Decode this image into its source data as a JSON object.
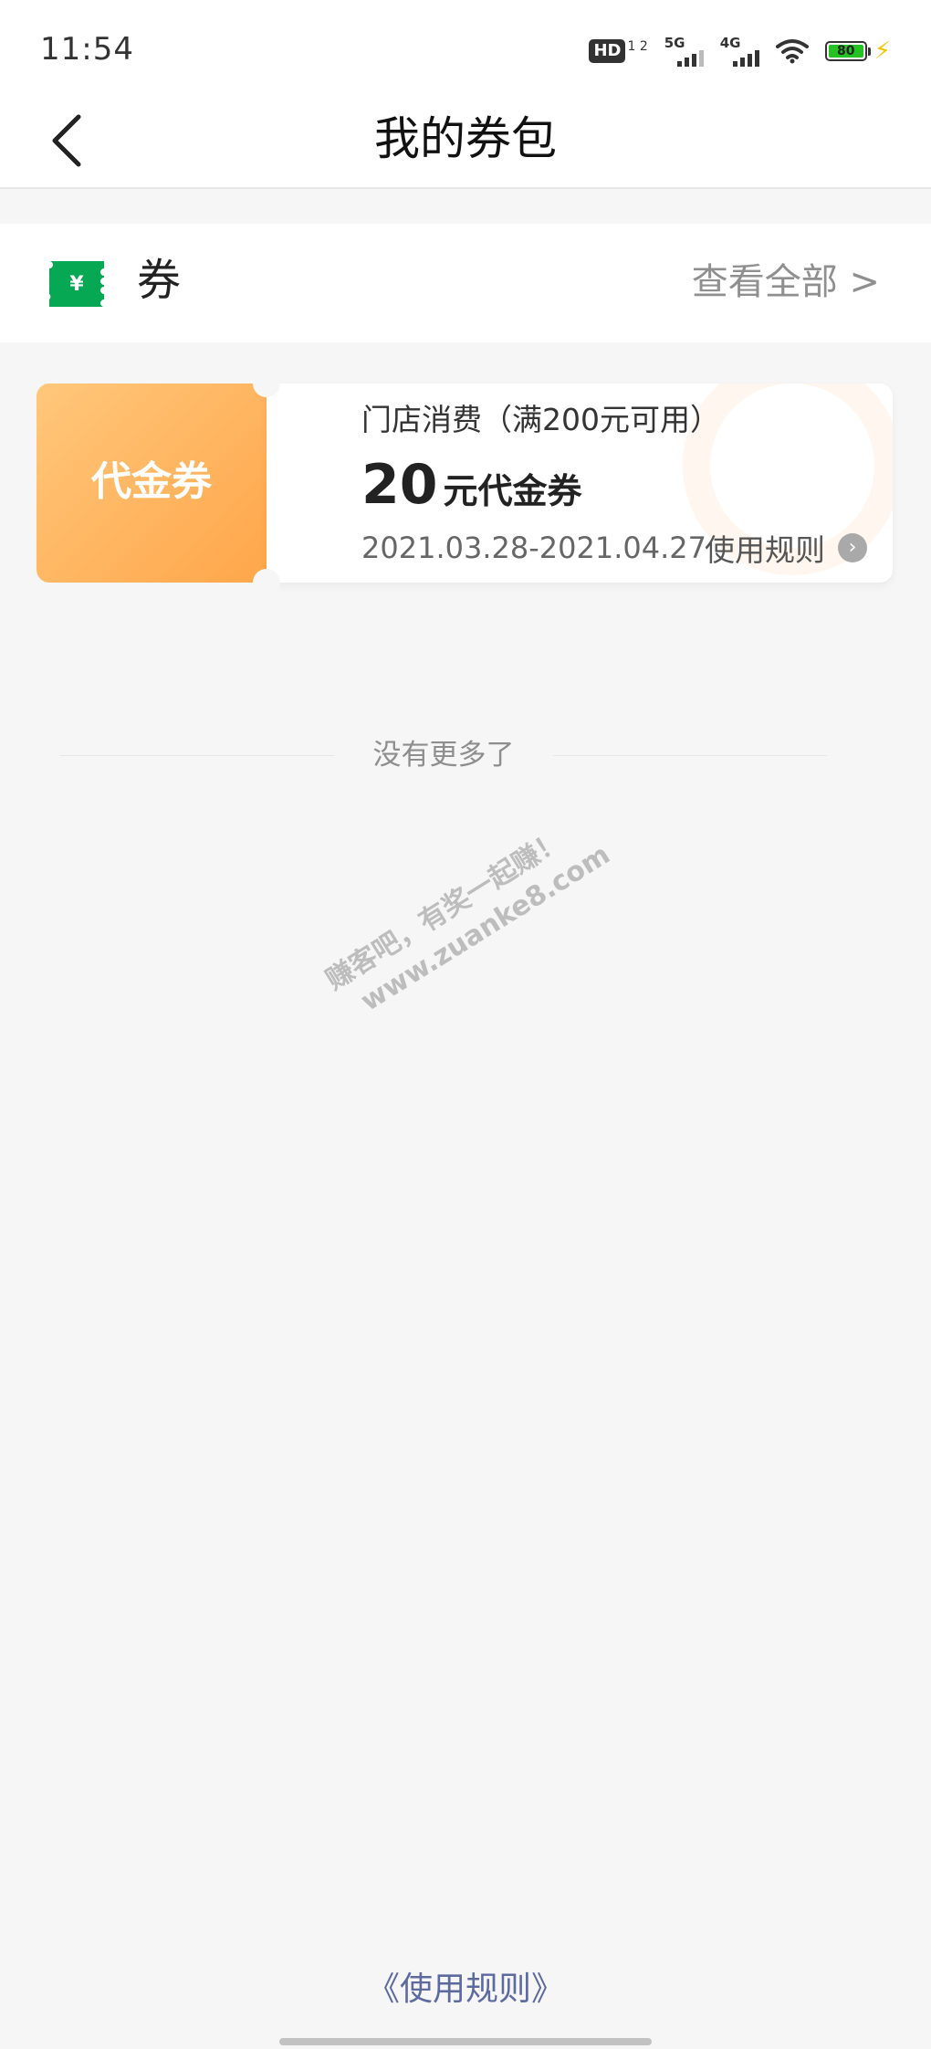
{
  "status_bar": {
    "time": "11:54",
    "hd_label": "HD",
    "hd_sub": "1 2",
    "sim1_label": "5G",
    "sim2_label": "4G",
    "battery_level": "80",
    "accent_battery": "#22c322"
  },
  "nav": {
    "title": "我的券包"
  },
  "voucher_section": {
    "title": "券",
    "icon_symbol": "¥",
    "icon_color": "#07a854",
    "view_all": "查看全部 >"
  },
  "coupon": {
    "type_label": "代金券",
    "condition": "门店消费（满200元可用）",
    "amount": "20",
    "amount_unit": "元代金券",
    "validity": "2021.03.28-2021.04.27",
    "rules_link": "使用规则",
    "accent": "#ffb55f"
  },
  "list_end": {
    "text": "没有更多了"
  },
  "watermark": {
    "line1": "赚客吧，有奖一起赚！",
    "line2": "www.zuanke8.com"
  },
  "footer": {
    "rules_link": "《使用规则》"
  }
}
